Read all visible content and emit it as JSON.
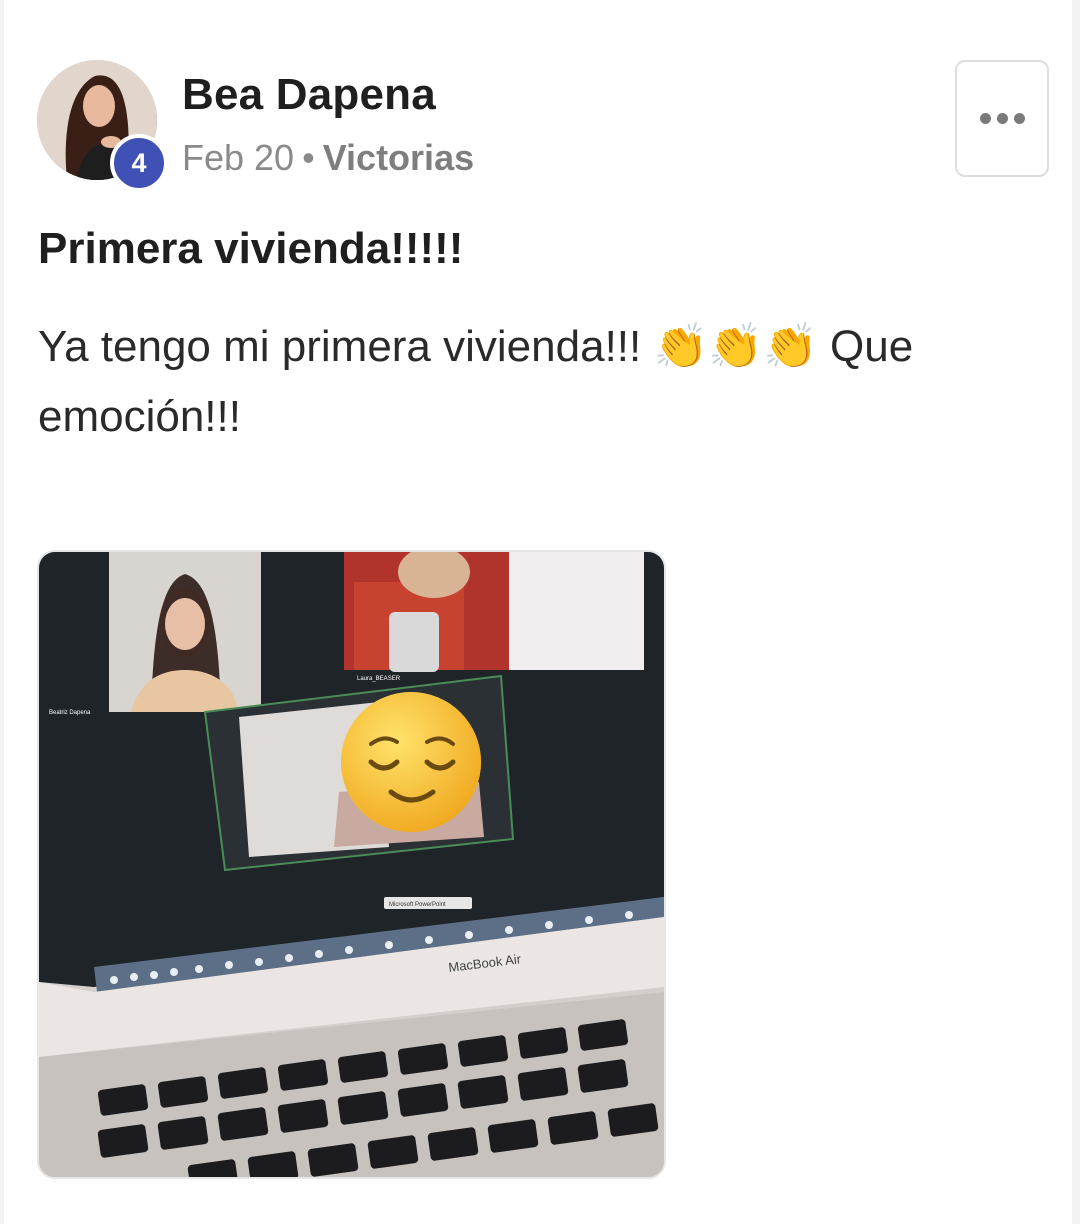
{
  "post": {
    "author": {
      "name": "Bea Dapena",
      "level": "4"
    },
    "meta": {
      "date": "Feb 20",
      "separator": "•",
      "group": "Victorias"
    },
    "more_icon": "more-horizontal-icon",
    "title": "Primera vivienda!!!!!",
    "body": "Ya tengo mi primera vivienda!!! 👏👏👏 Que emoción!!!",
    "photo": {
      "overlay_labels": {
        "participant_1": "Beatriz Dapena",
        "participant_2": "Laura_BEASER",
        "app_tooltip": "Microsoft PowerPoint",
        "laptop_brand": "MacBook Air"
      },
      "overlay_emoji": "😌"
    }
  },
  "colors": {
    "badge": "#3f51b5",
    "text": "#222222",
    "meta": "#8a8a8a"
  }
}
